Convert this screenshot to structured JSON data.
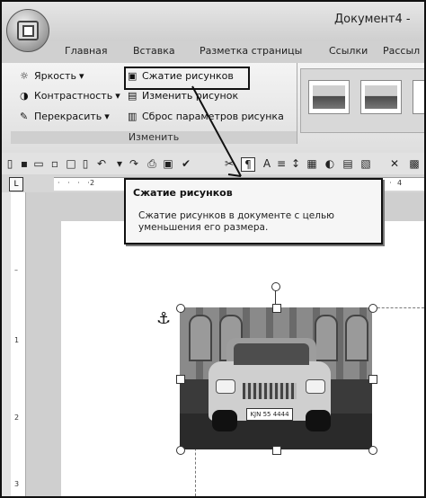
{
  "title_bar": {
    "document_title": "Документ4 -"
  },
  "tabs": [
    {
      "label": "Главная"
    },
    {
      "label": "Вставка"
    },
    {
      "label": "Разметка страницы"
    },
    {
      "label": "Ссылки"
    },
    {
      "label": "Рассыл"
    }
  ],
  "ribbon": {
    "adjust_group": {
      "label": "Изменить",
      "buttons": [
        {
          "label": "Яркость"
        },
        {
          "label": "Контрастность"
        },
        {
          "label": "Перекрасить"
        },
        {
          "label": "Сжатие рисунков"
        },
        {
          "label": "Изменить рисунок"
        },
        {
          "label": "Сброс параметров рисунка"
        }
      ]
    }
  },
  "ruler": {
    "h_ticks": [
      "2",
      "4"
    ],
    "v_ticks": [
      "1",
      "2",
      "3"
    ]
  },
  "picture": {
    "plate_text": "KJN 55 4444"
  },
  "tooltip": {
    "title": "Сжатие рисунков",
    "body": "Сжатие рисунков в документе с целью уменьшения его размера."
  }
}
